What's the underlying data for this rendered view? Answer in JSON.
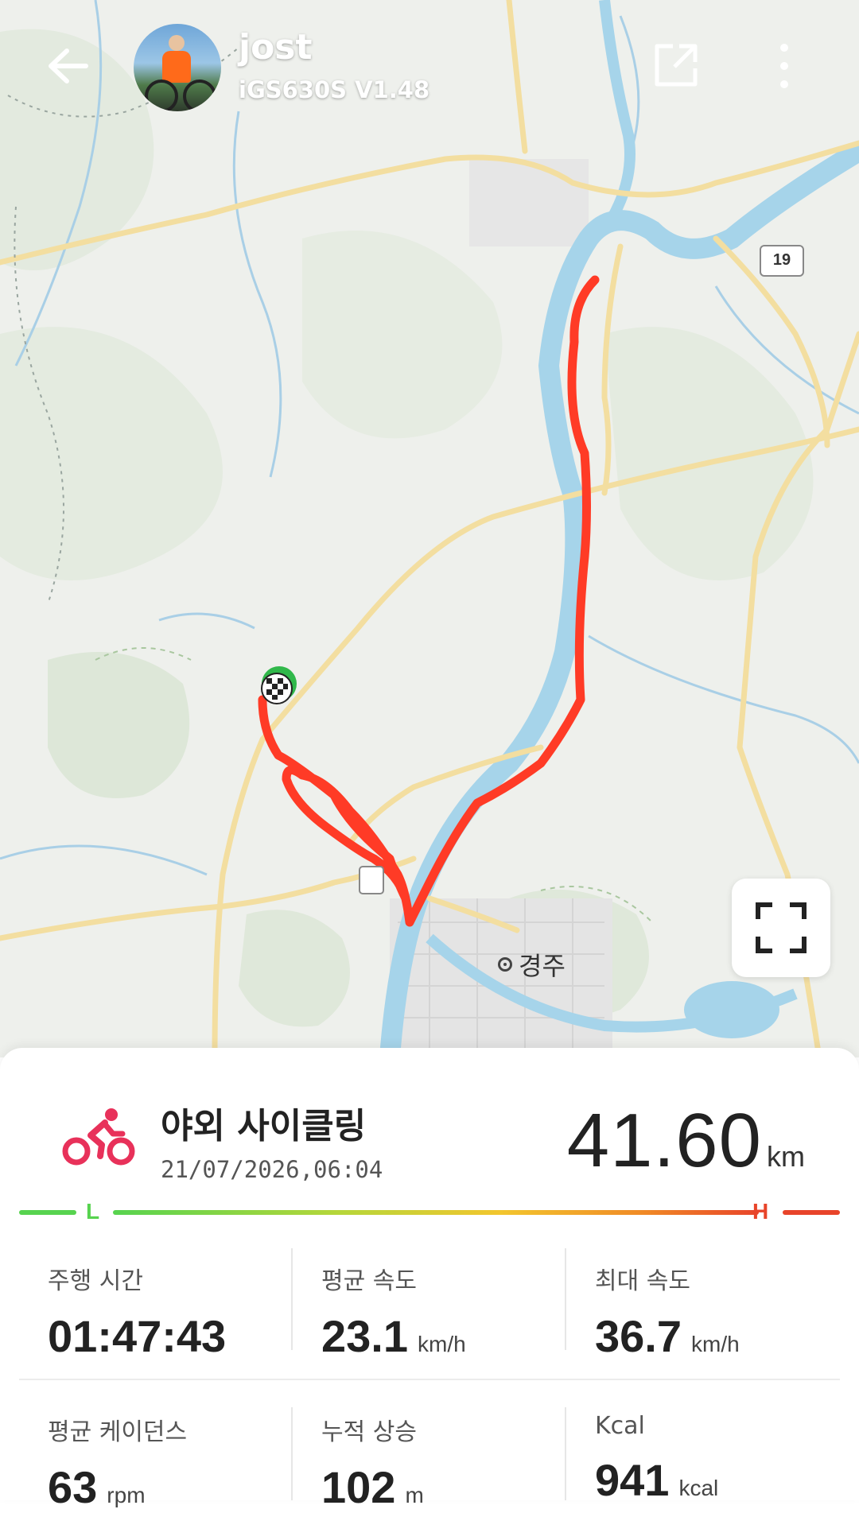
{
  "header": {
    "user_name": "jost",
    "device": "iGS630S  V1.48"
  },
  "map": {
    "city_label": "경주",
    "route_badge": "19"
  },
  "activity": {
    "title": "야외 사이클링",
    "date": "21/07/2026,06:04",
    "distance_value": "41.60",
    "distance_unit": "km",
    "accent_color": "#e8315a"
  },
  "scale": {
    "low_label": "L",
    "high_label": "H"
  },
  "stats": [
    {
      "label": "주행 시간",
      "value": "01:47:43",
      "unit": ""
    },
    {
      "label": "평균 속도",
      "value": "23.1",
      "unit": "km/h"
    },
    {
      "label": "최대 속도",
      "value": "36.7",
      "unit": "km/h"
    },
    {
      "label": "평균 케이던스",
      "value": "63",
      "unit": "rpm"
    },
    {
      "label": "누적 상승",
      "value": "102",
      "unit": "m"
    },
    {
      "label": "Kcal",
      "value": "941",
      "unit": "kcal"
    }
  ],
  "icons": [
    "back-arrow-icon",
    "share-icon",
    "more-vertical-icon",
    "fullscreen-icon",
    "cycling-icon",
    "finish-flag-icon"
  ]
}
